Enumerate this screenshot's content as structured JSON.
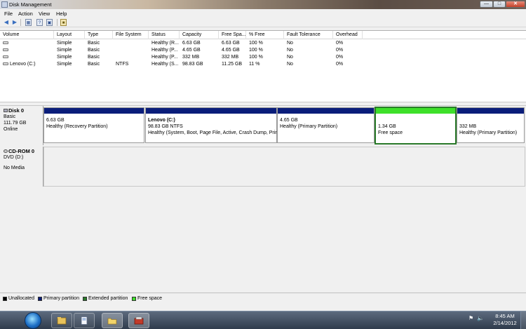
{
  "window": {
    "title": "Disk Management",
    "controls": {
      "minimize": "—",
      "maximize": "□",
      "close": "✕"
    }
  },
  "menu": [
    "File",
    "Action",
    "View",
    "Help"
  ],
  "toolbar_icons": [
    "back-arrow-icon",
    "forward-arrow-icon",
    "properties-icon",
    "help-icon",
    "disk-icon"
  ],
  "volume_list": {
    "columns": [
      "Volume",
      "Layout",
      "Type",
      "File System",
      "Status",
      "Capacity",
      "Free Spa...",
      "% Free",
      "Fault Tolerance",
      "Overhead"
    ],
    "rows": [
      [
        "",
        "Simple",
        "Basic",
        "",
        "Healthy (R...",
        "6.63 GB",
        "6.63 GB",
        "100 %",
        "No",
        "0%"
      ],
      [
        "",
        "Simple",
        "Basic",
        "",
        "Healthy (P...",
        "4.65 GB",
        "4.65 GB",
        "100 %",
        "No",
        "0%"
      ],
      [
        "",
        "Simple",
        "Basic",
        "",
        "Healthy (P...",
        "332 MB",
        "332 MB",
        "100 %",
        "No",
        "0%"
      ],
      [
        "Lenovo (C:)",
        "Simple",
        "Basic",
        "NTFS",
        "Healthy (S...",
        "98.83 GB",
        "11.25 GB",
        "11 %",
        "No",
        "0%"
      ]
    ]
  },
  "disk0": {
    "name": "Disk 0",
    "type": "Basic",
    "size": "111.79 GB",
    "state": "Online",
    "partitions": [
      {
        "name": "",
        "size": "6.63 GB",
        "status": "Healthy (Recovery Partition)",
        "bar_color": "#0a1d7a"
      },
      {
        "name": "Lenovo  (C:)",
        "size": "98.83 GB NTFS",
        "status": "Healthy (System, Boot, Page File, Active, Crash Dump, Prir",
        "bar_color": "#0a1d7a"
      },
      {
        "name": "",
        "size": "4.65 GB",
        "status": "Healthy (Primary Partition)",
        "bar_color": "#0a1d7a"
      },
      {
        "name": "",
        "size": "1.34 GB",
        "status": "Free space",
        "bar_color": "#3ee02a"
      },
      {
        "name": "",
        "size": "332 MB",
        "status": "Healthy (Primary Partition)",
        "bar_color": "#0a1d7a"
      }
    ]
  },
  "cdrom0": {
    "name": "CD-ROM 0",
    "drive": "DVD (D:)",
    "media": "No Media"
  },
  "legend": [
    {
      "label": "Unallocated",
      "color": "#000000"
    },
    {
      "label": "Primary partition",
      "color": "#0a1d7a"
    },
    {
      "label": "Extended partition",
      "color": "#2a7a2a"
    },
    {
      "label": "Free space",
      "color": "#3ee02a"
    }
  ],
  "taskbar": {
    "apps": [
      "windows-explorer-icon",
      "document-icon",
      "folder-icon",
      "disk-management-icon"
    ],
    "tray_icons": [
      "flag-icon",
      "volume-icon"
    ],
    "time": "8:45 AM",
    "date": "2/14/2012"
  }
}
